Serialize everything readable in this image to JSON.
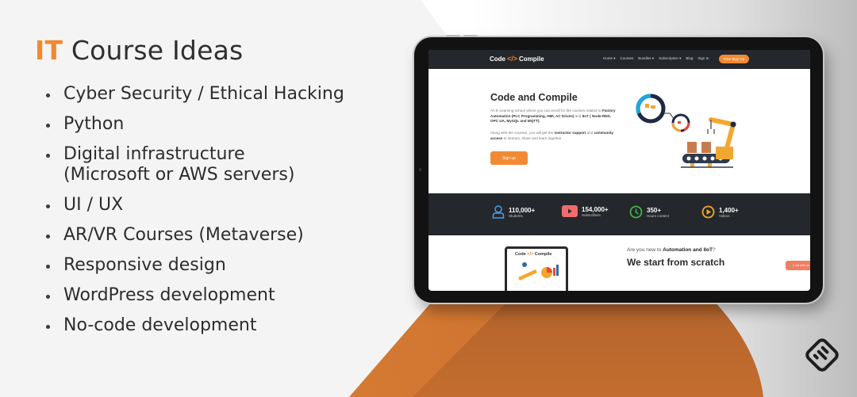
{
  "slide": {
    "title_accent": "IT",
    "title_rest": " Course Ideas",
    "ideas": [
      "Cyber Security / Ethical Hacking",
      "Python",
      "Digital infrastructure\n(Microsoft or AWS servers)",
      "UI / UX",
      "AR/VR Courses (Metaverse)",
      "Responsive design",
      "WordPress development",
      "No-code development"
    ],
    "colors": {
      "accent": "#ef8a30",
      "text": "#2d2d2d",
      "orange_shape": "#c46d2f"
    }
  },
  "website": {
    "logo": {
      "left": "Code",
      "bracket": "</>",
      "right": "Compile"
    },
    "nav": {
      "links": [
        "Home ▾",
        "Courses",
        "Bundles ▾",
        "Subscription ▾",
        "Blog",
        "Sign In"
      ],
      "cta": "Free Sign Up"
    },
    "hero": {
      "title": "Code and Compile",
      "para1_pre": "An E-Learning school where you can enroll for the courses related to ",
      "para1_bold1": "Factory Automation (PLC Programming, HMI, AC Drives)",
      "para1_mid": " and ",
      "para1_bold2": "IIoT ( Node-RED, OPC UA, MySQL and MQTT).",
      "para2_pre": "Along with the courses, you will get the ",
      "para2_bold1": "instructor support",
      "para2_mid": " and ",
      "para2_bold2": "community access",
      "para2_post": " to interact, share and learn together",
      "button": "Sign up"
    },
    "stats": [
      {
        "icon": "user-icon",
        "value": "110,000+",
        "label": "Students",
        "color": "#4a9be8"
      },
      {
        "icon": "youtube-icon",
        "value": "154,000+",
        "label": "Subscribers",
        "color": "#f26b6b"
      },
      {
        "icon": "clock-icon",
        "value": "350+",
        "label": "Hours content",
        "color": "#3cb44a"
      },
      {
        "icon": "play-icon",
        "value": "1,400+",
        "label": "Videos",
        "color": "#f2a731"
      }
    ],
    "section2": {
      "question_pre": "Are you new to ",
      "question_bold": "Automation and IIoT",
      "question_post": "?",
      "heading": "We start from scratch",
      "mini_logo_left": "Code",
      "mini_logo_bracket": "</>",
      "mini_logo_right": "Compile"
    },
    "chat_button": "Chat with us"
  }
}
